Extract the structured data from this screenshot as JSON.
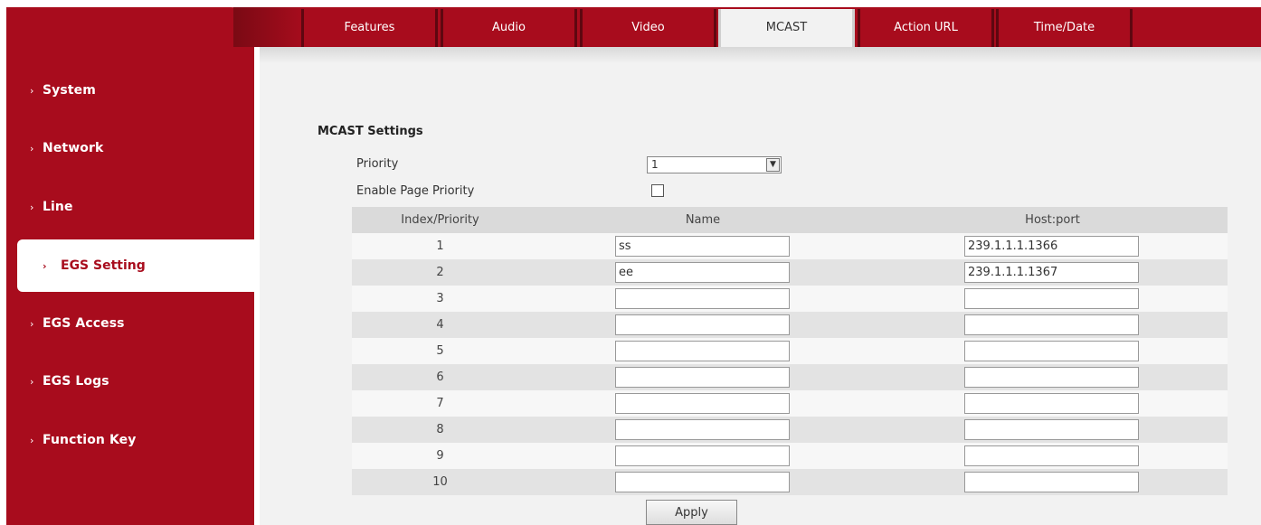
{
  "tabs": [
    {
      "label": "Features",
      "active": false
    },
    {
      "label": "Audio",
      "active": false
    },
    {
      "label": "Video",
      "active": false
    },
    {
      "label": "MCAST",
      "active": true
    },
    {
      "label": "Action URL",
      "active": false
    },
    {
      "label": "Time/Date",
      "active": false
    }
  ],
  "sidebar": {
    "items": [
      {
        "label": "System"
      },
      {
        "label": "Network"
      },
      {
        "label": "Line"
      },
      {
        "label": "EGS Setting",
        "active": true
      },
      {
        "label": "EGS Access"
      },
      {
        "label": "EGS Logs"
      },
      {
        "label": "Function Key"
      }
    ],
    "chevron": "›"
  },
  "settings": {
    "title": "MCAST Settings",
    "priority_label": "Priority",
    "priority_value": "1",
    "enable_page_priority_label": "Enable Page Priority",
    "enable_page_priority_checked": false
  },
  "table": {
    "headers": [
      "Index/Priority",
      "Name",
      "Host:port"
    ],
    "rows": [
      {
        "index": "1",
        "name": "ss",
        "host": "239.1.1.1.1366"
      },
      {
        "index": "2",
        "name": "ee",
        "host": "239.1.1.1.1367"
      },
      {
        "index": "3",
        "name": "",
        "host": ""
      },
      {
        "index": "4",
        "name": "",
        "host": ""
      },
      {
        "index": "5",
        "name": "",
        "host": ""
      },
      {
        "index": "6",
        "name": "",
        "host": ""
      },
      {
        "index": "7",
        "name": "",
        "host": ""
      },
      {
        "index": "8",
        "name": "",
        "host": ""
      },
      {
        "index": "9",
        "name": "",
        "host": ""
      },
      {
        "index": "10",
        "name": "",
        "host": ""
      }
    ]
  },
  "apply_label": "Apply",
  "colors": {
    "brand": "#a80c1d",
    "content_bg": "#f2f2f2"
  }
}
